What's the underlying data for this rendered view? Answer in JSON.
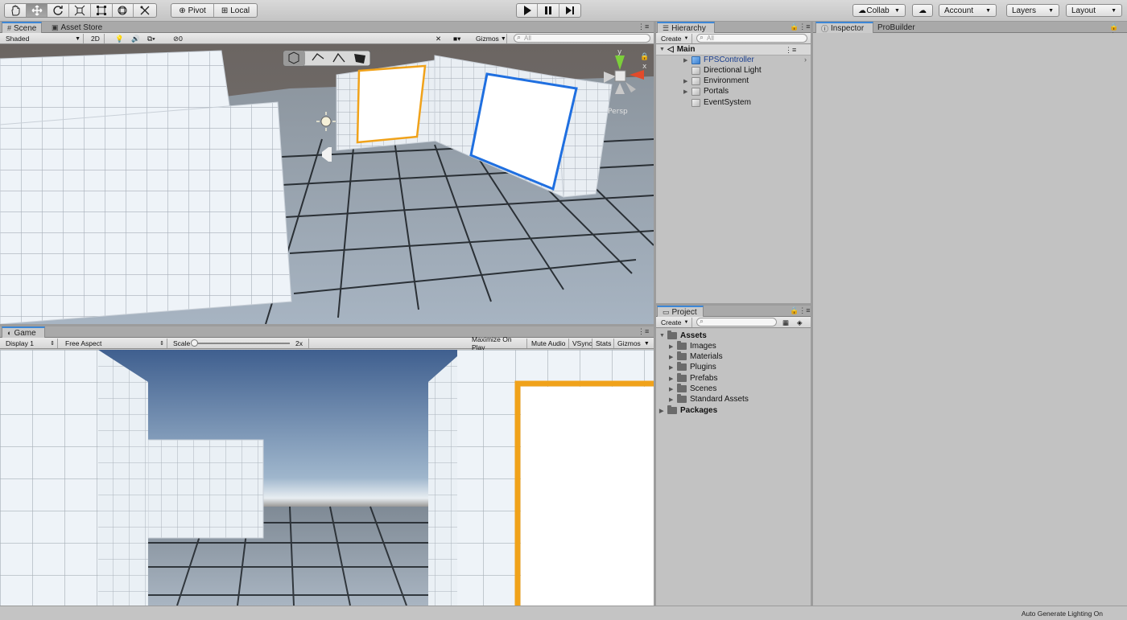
{
  "toolbar": {
    "tools": [
      "hand-tool",
      "move-tool",
      "rotate-tool",
      "scale-tool",
      "rect-tool",
      "transform-tool",
      "custom-tool"
    ],
    "active_tool": "move-tool",
    "pivot_label": "Pivot",
    "local_label": "Local",
    "play_controls": [
      "play",
      "pause",
      "step"
    ],
    "collab_label": "Collab",
    "account_label": "Account",
    "layers_label": "Layers",
    "layout_label": "Layout"
  },
  "scene": {
    "tab_label": "Scene",
    "asset_store_label": "Asset Store",
    "shading_mode": "Shaded",
    "mode_2d": "2D",
    "hidden_count": "0",
    "gizmos_label": "Gizmos",
    "search_placeholder": "All",
    "persp_label": "Persp",
    "axis_y": "y",
    "axis_x": "x"
  },
  "game": {
    "tab_label": "Game",
    "display": "Display 1",
    "aspect": "Free Aspect",
    "scale_label": "Scale",
    "scale_value": "2x",
    "maximize_label": "Maximize On Play",
    "mute_label": "Mute Audio",
    "vsync_label": "VSync",
    "stats_label": "Stats",
    "gizmos_label": "Gizmos"
  },
  "hierarchy": {
    "tab_label": "Hierarchy",
    "create_label": "Create",
    "search_placeholder": "All",
    "scene_name": "Main",
    "items": [
      {
        "label": "FPSController",
        "expandable": true,
        "prefab": true
      },
      {
        "label": "Directional Light",
        "expandable": false,
        "prefab": false
      },
      {
        "label": "Environment",
        "expandable": true,
        "prefab": false
      },
      {
        "label": "Portals",
        "expandable": true,
        "prefab": false
      },
      {
        "label": "EventSystem",
        "expandable": false,
        "prefab": false
      }
    ]
  },
  "project": {
    "tab_label": "Project",
    "create_label": "Create",
    "root": "Assets",
    "folders": [
      "Images",
      "Materials",
      "Plugins",
      "Prefabs",
      "Scenes",
      "Standard Assets"
    ],
    "packages_label": "Packages"
  },
  "inspector": {
    "tab_label": "Inspector",
    "probuilder_label": "ProBuilder"
  },
  "status": {
    "text": "Auto Generate Lighting On"
  },
  "colors": {
    "portal_orange": "#f0a21a",
    "portal_blue": "#1f6fe0",
    "tab_accent": "#3c87d6",
    "prefab_blue": "#1b3f8f"
  }
}
